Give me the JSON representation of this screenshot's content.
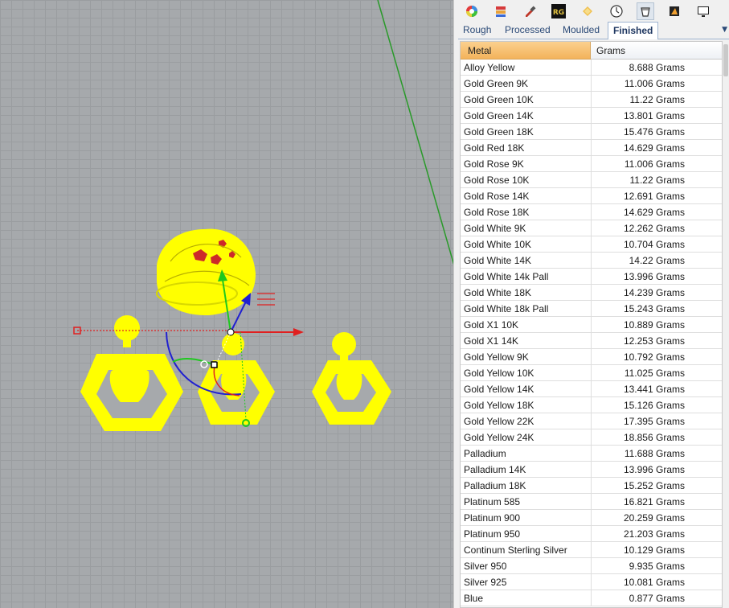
{
  "toolbar": {
    "icons": [
      "color-wheel-icon",
      "layers-icon",
      "eyedropper-icon",
      "rg-logo-icon",
      "gem-icon",
      "clock-icon",
      "weight-bucket-icon",
      "render-icon",
      "monitor-icon"
    ],
    "active_index": 6,
    "rg_label": "RG"
  },
  "tabs": [
    {
      "label": "Rough"
    },
    {
      "label": "Processed"
    },
    {
      "label": "Moulded"
    },
    {
      "label": "Finished",
      "active": true
    }
  ],
  "table": {
    "headers": {
      "metal": "Metal",
      "grams": "Grams"
    },
    "rows": [
      {
        "metal": "Alloy Yellow",
        "grams": "8.688 Grams"
      },
      {
        "metal": "Gold Green 9K",
        "grams": "11.006 Grams"
      },
      {
        "metal": "Gold Green 10K",
        "grams": "11.22 Grams"
      },
      {
        "metal": "Gold Green 14K",
        "grams": "13.801 Grams"
      },
      {
        "metal": "Gold Green 18K",
        "grams": "15.476 Grams"
      },
      {
        "metal": "Gold Red 18K",
        "grams": "14.629 Grams"
      },
      {
        "metal": "Gold Rose 9K",
        "grams": "11.006 Grams"
      },
      {
        "metal": "Gold Rose 10K",
        "grams": "11.22 Grams"
      },
      {
        "metal": "Gold Rose 14K",
        "grams": "12.691 Grams"
      },
      {
        "metal": "Gold Rose 18K",
        "grams": "14.629 Grams"
      },
      {
        "metal": "Gold White 9K",
        "grams": "12.262 Grams"
      },
      {
        "metal": "Gold White 10K",
        "grams": "10.704 Grams"
      },
      {
        "metal": "Gold White 14K",
        "grams": "14.22 Grams"
      },
      {
        "metal": "Gold White 14k Pall",
        "grams": "13.996 Grams"
      },
      {
        "metal": "Gold White 18K",
        "grams": "14.239 Grams"
      },
      {
        "metal": "Gold White 18k Pall",
        "grams": "15.243 Grams"
      },
      {
        "metal": "Gold X1 10K",
        "grams": "10.889 Grams"
      },
      {
        "metal": "Gold X1 14K",
        "grams": "12.253 Grams"
      },
      {
        "metal": "Gold Yellow 9K",
        "grams": "10.792 Grams"
      },
      {
        "metal": "Gold Yellow 10K",
        "grams": "11.025 Grams"
      },
      {
        "metal": "Gold Yellow 14K",
        "grams": "13.441 Grams"
      },
      {
        "metal": "Gold Yellow 18K",
        "grams": "15.126 Grams"
      },
      {
        "metal": "Gold Yellow 22K",
        "grams": "17.395 Grams"
      },
      {
        "metal": "Gold Yellow 24K",
        "grams": "18.856 Grams"
      },
      {
        "metal": "Palladium",
        "grams": "11.688 Grams"
      },
      {
        "metal": "Palladium 14K",
        "grams": "13.996 Grams"
      },
      {
        "metal": "Palladium 18K",
        "grams": "15.252 Grams"
      },
      {
        "metal": "Platinum 585",
        "grams": "16.821 Grams"
      },
      {
        "metal": "Platinum 900",
        "grams": "20.259 Grams"
      },
      {
        "metal": "Platinum 950",
        "grams": "21.203 Grams"
      },
      {
        "metal": "Continum Sterling Silver",
        "grams": "10.129 Grams"
      },
      {
        "metal": "Silver 950",
        "grams": "9.935 Grams"
      },
      {
        "metal": "Silver 925",
        "grams": "10.081 Grams"
      },
      {
        "metal": "Blue",
        "grams": "0.877 Grams"
      }
    ]
  },
  "colors": {
    "object_yellow": "#ffff00",
    "header_orange": "#f6c06f",
    "gumball_x": "#e02020",
    "gumball_y": "#1ec81e",
    "gumball_z": "#2020d0",
    "world_y_axis": "#2a9a2a",
    "tab_text": "#2b4a77"
  }
}
